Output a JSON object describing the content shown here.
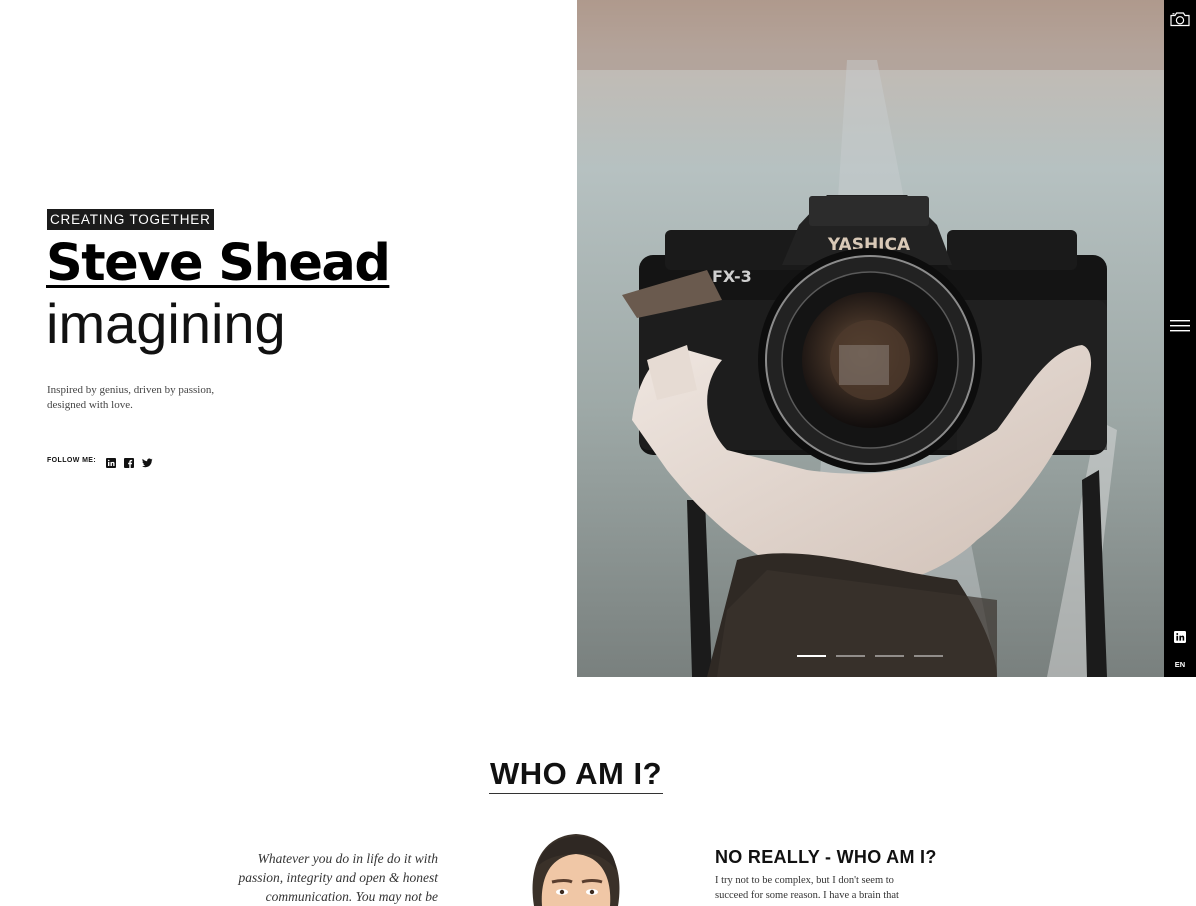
{
  "hero": {
    "tagline": "CREATING TOGETHER",
    "name": "Steve Shead",
    "role": "imagining",
    "intro": "Inspired by genius, driven by passion, designed with love.",
    "follow_label": "FOLLOW ME:",
    "social_icons": [
      "linkedin-icon",
      "facebook-icon",
      "twitter-icon"
    ],
    "slides_total": 4,
    "slide_active": 1,
    "photo_subject": "Hand holding a YASHICA FX-3 camera, lens: YASHICA LENS ML 50mm 1:1.4, MADE IN JAPAN",
    "camera_brand": "YASHICA",
    "camera_model": "FX-3"
  },
  "sidebar": {
    "icons": [
      "camera-icon",
      "menu-icon",
      "linkedin-icon"
    ],
    "language": "EN",
    "background": "#000000"
  },
  "about": {
    "title": "WHO AM I?",
    "quote": "Whatever you do in life do it with passion, integrity and open & honest communication. You may not be",
    "really_title": "NO REALLY - WHO AM I?",
    "really_text": "I try not to be complex, but I don't seem to succeed for some reason. I have a brain that"
  },
  "colors": {
    "tag_background": "#1b1b1b",
    "text": "#111111",
    "accent": "#000000"
  }
}
